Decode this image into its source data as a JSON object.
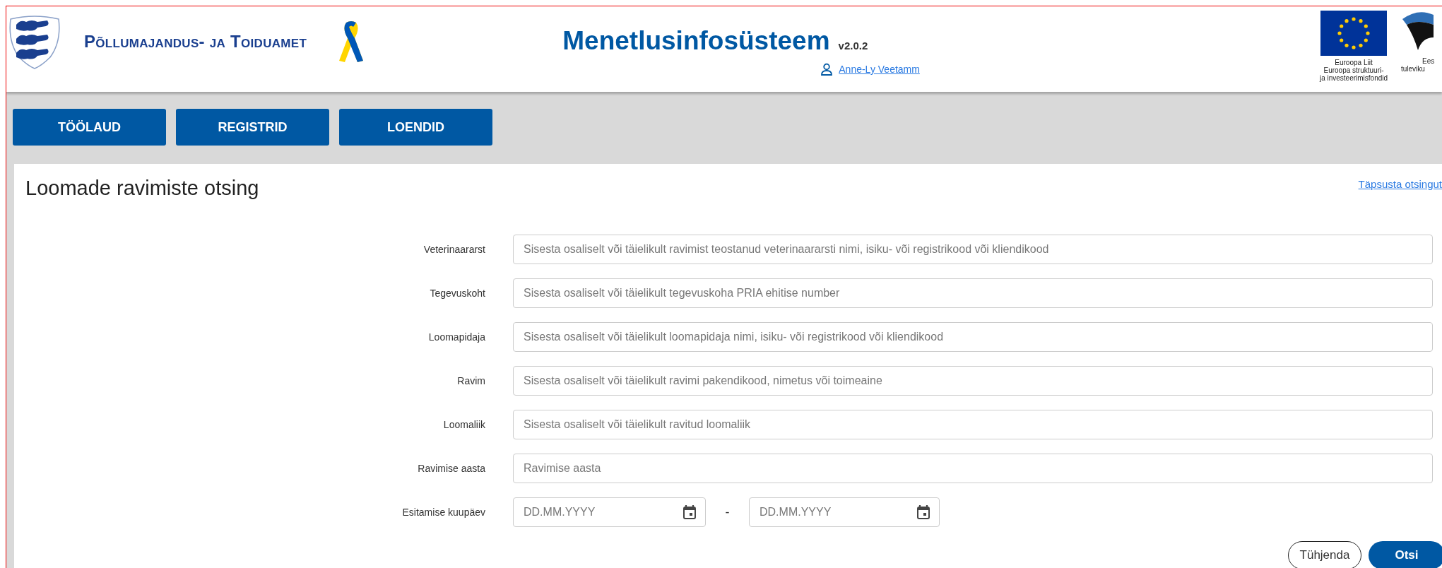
{
  "header": {
    "agency": "Põllumajandus- ja Toiduamet",
    "app_title": "Menetlusinfosüsteem",
    "version": "v2.0.2",
    "user": "Anne-Ly Veetamm",
    "eu_caption": [
      "Euroopa Liit",
      "Euroopa struktuuri-",
      "ja investeerimisfondid"
    ],
    "partner_caption": [
      "Ees",
      "tuleviku"
    ]
  },
  "nav": [
    {
      "label": "TÖÖLAUD"
    },
    {
      "label": "REGISTRID"
    },
    {
      "label": "LOENDID"
    }
  ],
  "page_title": "Loomade ravimiste otsing",
  "refine_link": "Täpsusta otsingut",
  "fields": [
    {
      "kind": "text",
      "label": "Veterinaararst",
      "placeholder": "Sisesta osaliselt või täielikult ravimist teostanud veterinaararsti nimi, isiku- või registrikood või kliendikood"
    },
    {
      "kind": "text",
      "label": "Tegevuskoht",
      "placeholder": "Sisesta osaliselt või täielikult tegevuskoha PRIA ehitise number"
    },
    {
      "kind": "text",
      "label": "Loomapidaja",
      "placeholder": "Sisesta osaliselt või täielikult loomapidaja nimi, isiku- või registrikood või kliendikood"
    },
    {
      "kind": "text",
      "label": "Ravim",
      "placeholder": "Sisesta osaliselt või täielikult ravimi pakendikood, nimetus või toimeaine"
    },
    {
      "kind": "text",
      "label": "Loomaliik",
      "placeholder": "Sisesta osaliselt või täielikult ravitud loomaliik"
    },
    {
      "kind": "text",
      "label": "Ravimise aasta",
      "placeholder": "Ravimise aasta"
    },
    {
      "kind": "date_range",
      "label": "Esitamise kuupäev",
      "placeholders": [
        "DD.MM.YYYY",
        "DD.MM.YYYY"
      ],
      "separator": "-"
    }
  ],
  "actions": [
    {
      "kind": "secondary",
      "label": "Tühjenda"
    },
    {
      "kind": "primary",
      "label": "Otsi"
    }
  ]
}
